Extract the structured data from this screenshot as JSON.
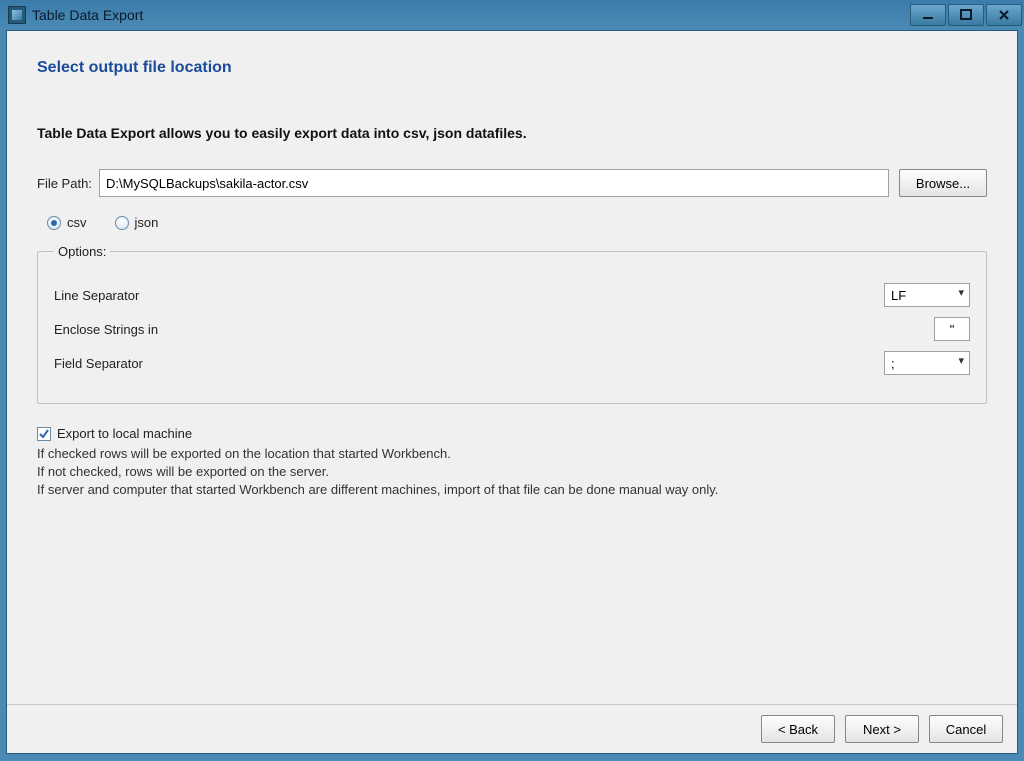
{
  "window": {
    "title": "Table Data Export"
  },
  "page": {
    "heading": "Select output file location",
    "intro": "Table Data Export allows you to easily export data into csv, json datafiles."
  },
  "filepath": {
    "label": "File Path:",
    "value": "D:\\MySQLBackups\\sakila-actor.csv",
    "browse": "Browse..."
  },
  "format": {
    "csv_label": "csv",
    "json_label": "json",
    "selected": "csv"
  },
  "options": {
    "legend": "Options:",
    "line_separator_label": "Line Separator",
    "line_separator_value": "LF",
    "enclose_label": "Enclose Strings in",
    "enclose_value": "\"",
    "field_separator_label": "Field Separator",
    "field_separator_value": ";"
  },
  "export_local": {
    "label": "Export to local machine",
    "checked": true,
    "help_line1": "If checked rows will be exported on the location that started Workbench.",
    "help_line2": "If not checked, rows will be exported on the server.",
    "help_line3": "If server and computer that started Workbench are different machines, import of that file can be done manual way only."
  },
  "buttons": {
    "back": "< Back",
    "next": "Next >",
    "cancel": "Cancel"
  }
}
